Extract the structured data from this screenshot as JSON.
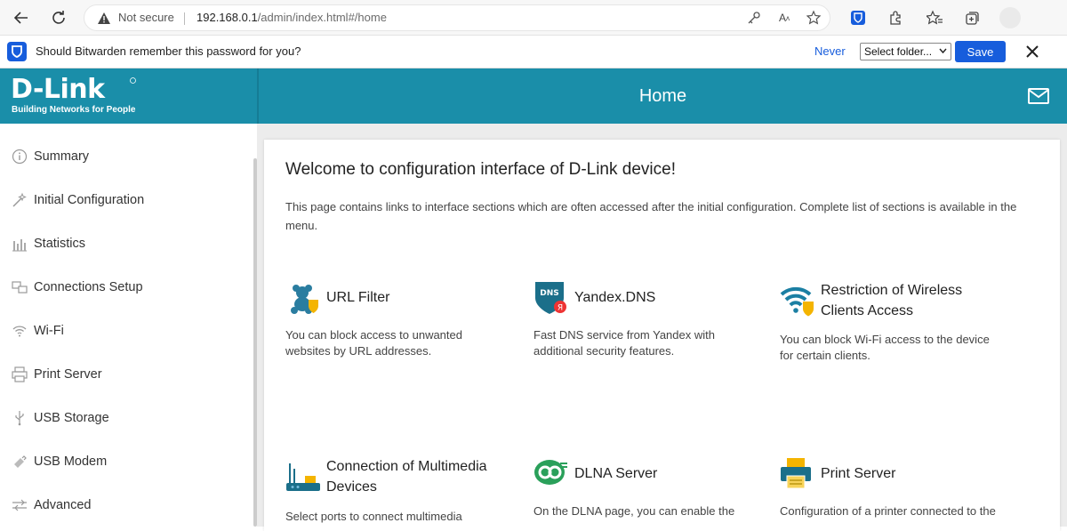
{
  "browser": {
    "not_secure": "Not secure",
    "url_host": "192.168.0.1",
    "url_path": "/admin/index.html#/home"
  },
  "bitwarden": {
    "message": "Should Bitwarden remember this password for you?",
    "never": "Never",
    "folder_select": "Select folder...",
    "save": "Save"
  },
  "header": {
    "brand": "D-Link",
    "tagline": "Building Networks for People",
    "title": "Home"
  },
  "sidebar": {
    "items": [
      {
        "label": "Summary",
        "icon": "info-icon"
      },
      {
        "label": "Initial Configuration",
        "icon": "wand-icon"
      },
      {
        "label": "Statistics",
        "icon": "bar-chart-icon"
      },
      {
        "label": "Connections Setup",
        "icon": "connections-icon"
      },
      {
        "label": "Wi-Fi",
        "icon": "wifi-icon"
      },
      {
        "label": "Print Server",
        "icon": "printer-icon"
      },
      {
        "label": "USB Storage",
        "icon": "usb-icon"
      },
      {
        "label": "USB Modem",
        "icon": "usb-modem-icon"
      },
      {
        "label": "Advanced",
        "icon": "sliders-icon"
      }
    ]
  },
  "main": {
    "welcome": "Welcome to configuration interface of D-Link device!",
    "intro": "This page contains links to interface sections which are often accessed after the initial configuration. Complete list of sections is available in the menu.",
    "tiles": [
      {
        "title": "URL Filter",
        "desc": "You can block access to unwanted websites by URL addresses.",
        "icon": "teddy-shield-icon"
      },
      {
        "title": "Yandex.DNS",
        "desc": "Fast DNS service from Yandex with additional security features.",
        "icon": "dns-shield-icon"
      },
      {
        "title": "Restriction of Wireless Clients Access",
        "desc": "You can block Wi-Fi access to the device for certain clients.",
        "icon": "wifi-shield-icon"
      },
      {
        "title": "Connection of Multimedia Devices",
        "desc": "Select ports to connect multimedia",
        "icon": "multimedia-router-icon"
      },
      {
        "title": "DLNA Server",
        "desc": "On the DLNA page, you can enable the",
        "icon": "dlna-icon"
      },
      {
        "title": "Print Server",
        "desc": "Configuration of a printer connected to the",
        "icon": "printer-color-icon"
      }
    ]
  },
  "colors": {
    "header": "#1a8ea9",
    "bitwarden_blue": "#175ddc",
    "sidebar_text": "#333333"
  }
}
